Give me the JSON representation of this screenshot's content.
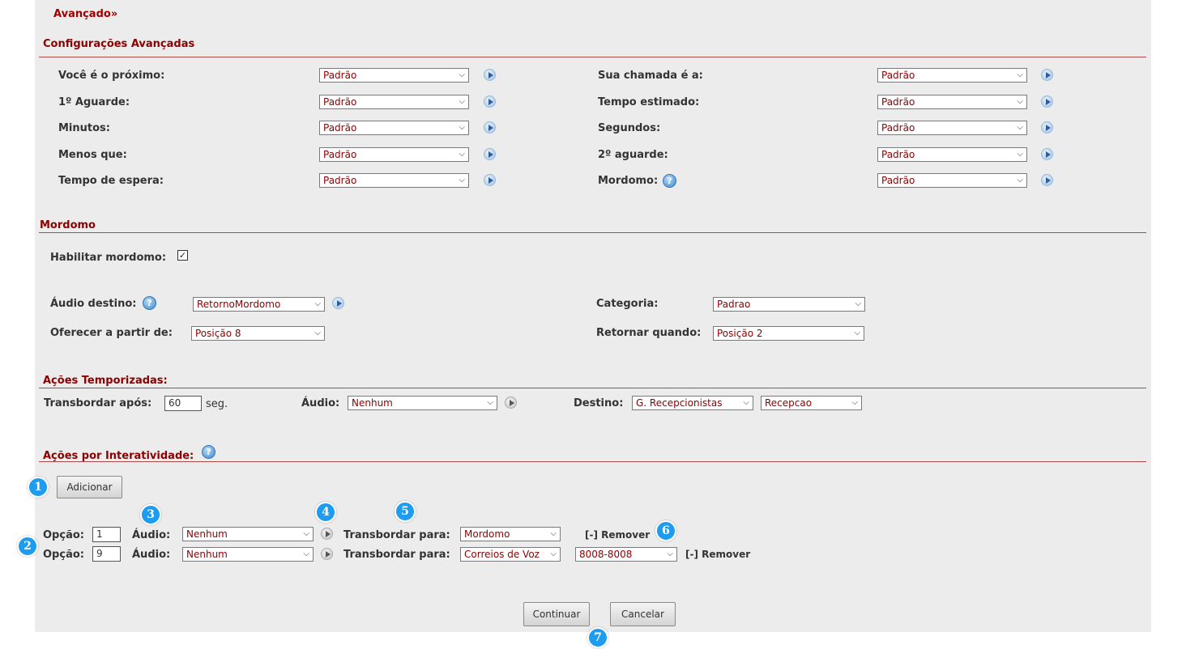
{
  "page": {
    "title": "Avançado",
    "title_suffix": "»"
  },
  "advanced": {
    "header": "Configurações Avançadas",
    "left": [
      {
        "label": "Você é o próximo:",
        "value": "Padrão"
      },
      {
        "label": "1º Aguarde:",
        "value": "Padrão"
      },
      {
        "label": "Minutos:",
        "value": "Padrão"
      },
      {
        "label": "Menos que:",
        "value": "Padrão"
      },
      {
        "label": "Tempo de espera:",
        "value": "Padrão"
      }
    ],
    "right": [
      {
        "label": "Sua chamada é a:",
        "value": "Padrão"
      },
      {
        "label": "Tempo estimado:",
        "value": "Padrão"
      },
      {
        "label": "Segundos:",
        "value": "Padrão"
      },
      {
        "label": "2º aguarde:",
        "value": "Padrão"
      },
      {
        "label": "Mordomo:",
        "value": "Padrão"
      }
    ]
  },
  "mordomo": {
    "header": "Mordomo",
    "enable_label": "Habilitar mordomo:",
    "enable_checked": true,
    "audio_label": "Áudio destino:",
    "audio_value": "RetornoMordomo",
    "offer_label": "Oferecer a partir de:",
    "offer_value": "Posição 8",
    "category_label": "Categoria:",
    "category_value": "Padrao",
    "return_label": "Retornar quando:",
    "return_value": "Posição 2"
  },
  "timed": {
    "header": "Ações Temporizadas:",
    "overflow_label": "Transbordar após:",
    "overflow_value": "60",
    "unit": "seg.",
    "audio_label": "Áudio:",
    "audio_value": "Nenhum",
    "dest_label": "Destino:",
    "dest_value": "G. Recepcionistas",
    "dest_value2": "Recepcao"
  },
  "interactive": {
    "header": "Ações por Interatividade:",
    "add_button": "Adicionar",
    "rows": [
      {
        "option_label": "Opção:",
        "option": "1",
        "audio_label": "Áudio:",
        "audio": "Nenhum",
        "transfer_label": "Transbordar para:",
        "transfer": "Mordomo",
        "extra": "",
        "remove": "[-] Remover"
      },
      {
        "option_label": "Opção:",
        "option": "9",
        "audio_label": "Áudio:",
        "audio": "Nenhum",
        "transfer_label": "Transbordar para:",
        "transfer": "Correios de Voz",
        "extra": "8008-8008",
        "remove": "[-] Remover"
      }
    ]
  },
  "actions": {
    "continue": "Continuar",
    "cancel": "Cancelar"
  },
  "badges": [
    "1",
    "2",
    "3",
    "4",
    "5",
    "6",
    "7"
  ],
  "colors": {
    "panel": "#ececec",
    "header_red": "#8b0000",
    "rule": "#a94a4a",
    "badge_blue": "#1e9cf0"
  }
}
